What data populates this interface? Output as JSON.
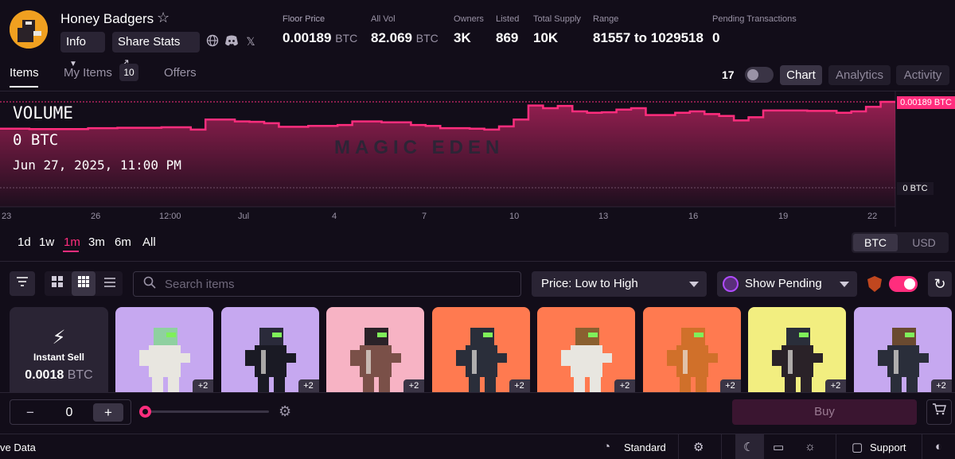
{
  "collection": {
    "title": "Honey Badgers",
    "info_label": "Info",
    "share_label": "Share Stats"
  },
  "stats": [
    {
      "label": "Floor Price",
      "value": "0.00189",
      "unit": "BTC"
    },
    {
      "label": "All Vol",
      "value": "82.069",
      "unit": "BTC"
    },
    {
      "label": "Owners",
      "value": "3K",
      "unit": ""
    },
    {
      "label": "Listed",
      "value": "869",
      "unit": ""
    },
    {
      "label": "Total Supply",
      "value": "10K",
      "unit": ""
    },
    {
      "label": "Range",
      "value": "81557 to 1029518",
      "unit": ""
    },
    {
      "label": "Pending Transactions",
      "value": "0",
      "unit": ""
    }
  ],
  "tabs": {
    "items": "Items",
    "my_items": "My Items",
    "my_items_count": "10",
    "offers": "Offers"
  },
  "view_buttons": {
    "chart": "Chart",
    "analytics": "Analytics",
    "activity": "Activity",
    "tv_logo": "17"
  },
  "chart_data": {
    "type": "area",
    "label": "VOLUME",
    "value_readout": "0 BTC",
    "date_readout": "Jun 27, 2025, 11:00 PM",
    "watermark": "MAGIC EDEN",
    "price_tag_top": "0.00189 BTC",
    "price_tag_zero": "0 BTC",
    "x_ticks": [
      "23",
      "26",
      "12:00",
      "Jul",
      "4",
      "7",
      "10",
      "13",
      "16",
      "19",
      "22"
    ],
    "series": [
      {
        "values": [
          0.0013,
          0.0013,
          0.00129,
          0.00129,
          0.00129,
          0.00129,
          0.00131,
          0.00131,
          0.00132,
          0.00132,
          0.00132,
          0.00133,
          0.00133,
          0.00128,
          0.0015,
          0.0015,
          0.00146,
          0.00145,
          0.00142,
          0.00134,
          0.00134,
          0.00136,
          0.00136,
          0.00138,
          0.00146,
          0.00146,
          0.00144,
          0.00144,
          0.00138,
          0.00136,
          0.00131,
          0.00131,
          0.0013,
          0.00128,
          0.00135,
          0.0015,
          0.00181,
          0.00175,
          0.0018,
          0.00168,
          0.00165,
          0.00166,
          0.00172,
          0.00175,
          0.0016,
          0.0016,
          0.00165,
          0.00168,
          0.00162,
          0.00158,
          0.00148,
          0.00155,
          0.0017,
          0.0017,
          0.0017,
          0.00169,
          0.00169,
          0.00165,
          0.00168,
          0.00178,
          0.00189,
          0.00189
        ]
      }
    ],
    "y_range": [
      0,
      0.00189
    ],
    "color": "#ff2d7d"
  },
  "ranges": {
    "d1": "1d",
    "w1": "1w",
    "m1": "1m",
    "m3": "3m",
    "m6": "6m",
    "all": "All"
  },
  "currency": {
    "btc": "BTC",
    "usd": "USD"
  },
  "search": {
    "placeholder": "Search items"
  },
  "sort": {
    "selected": "Price: Low to High"
  },
  "pending": {
    "label": "Show Pending"
  },
  "instant_sell": {
    "label": "Instant Sell",
    "value": "0.0018",
    "unit": "BTC"
  },
  "cards": [
    {
      "bg": "#c6a8f0",
      "body": "#e8e6e0",
      "head": "#8fd0a0",
      "plus": "+2"
    },
    {
      "bg": "#c6a8f0",
      "body": "#1a1a24",
      "head": "#2a2a3a",
      "plus": "+2"
    },
    {
      "bg": "#f7b3c4",
      "body": "#7a5048",
      "head": "#2a2228",
      "plus": "+2"
    },
    {
      "bg": "#ff7a50",
      "body": "#2a2e3a",
      "head": "#2a2e3a",
      "plus": "+2"
    },
    {
      "bg": "#ff7a50",
      "body": "#e8e6e0",
      "head": "#8a6030",
      "plus": "+2"
    },
    {
      "bg": "#ff7a50",
      "body": "#d0702a",
      "head": "#d0702a",
      "plus": "+2"
    },
    {
      "bg": "#f2ee80",
      "body": "#2a2228",
      "head": "#2a2e3a",
      "plus": "+2"
    },
    {
      "bg": "#c6a8f0",
      "body": "#2a2e3a",
      "head": "#6a4a30",
      "plus": "+2"
    }
  ],
  "quantity": {
    "minus": "−",
    "value": "0",
    "plus": "+"
  },
  "buy_label": "Buy",
  "footer": {
    "live": "ve Data",
    "standard": "Standard",
    "support": "Support"
  }
}
